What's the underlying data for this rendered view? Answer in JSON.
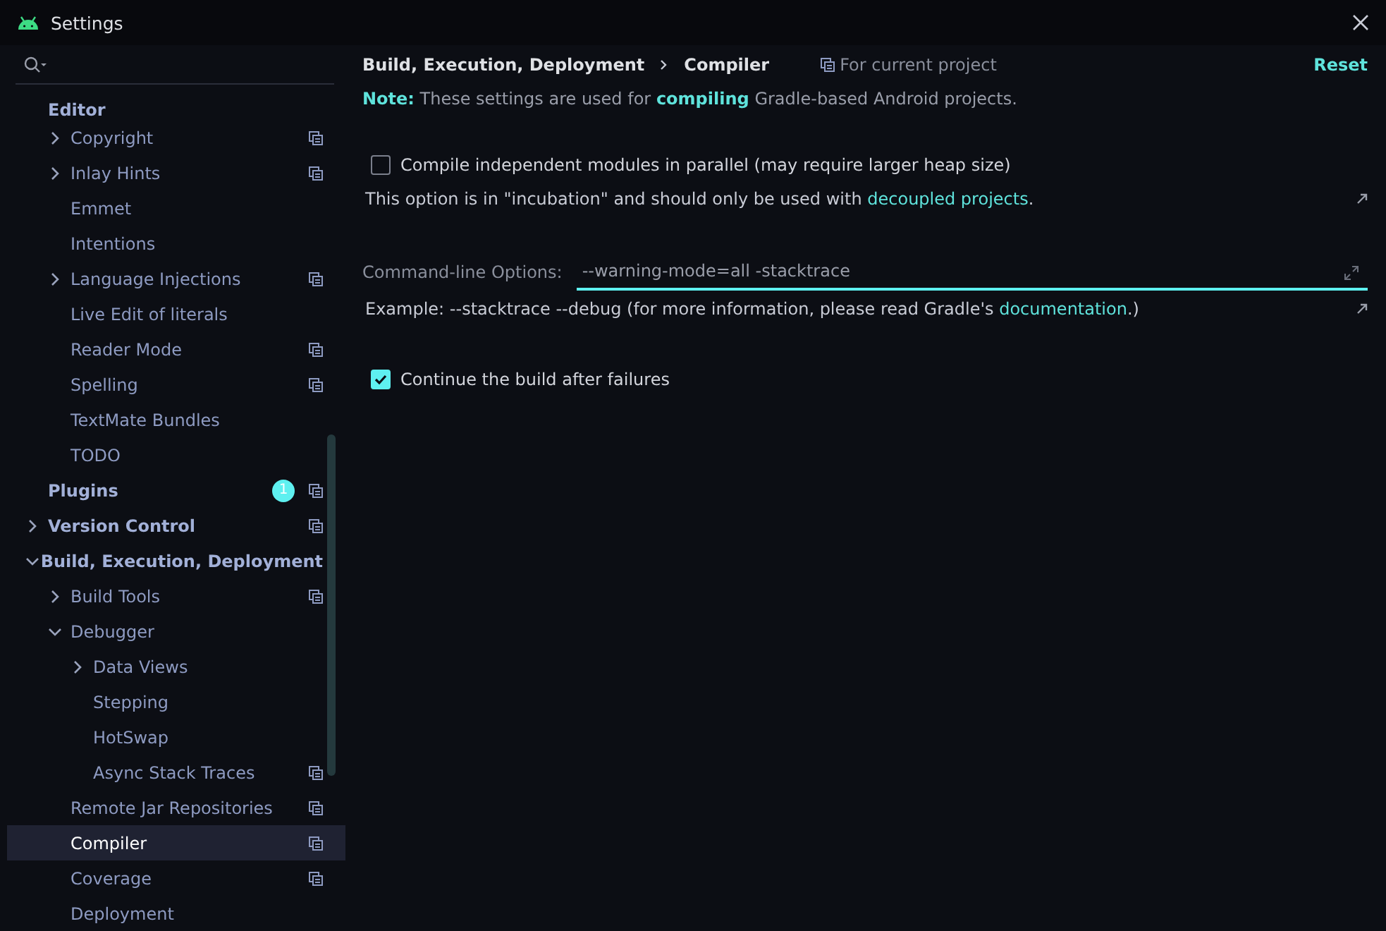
{
  "window": {
    "title": "Settings"
  },
  "sidebar": {
    "tree": [
      {
        "label": "Editor",
        "kind": "heading",
        "selected": false,
        "children": [
          {
            "label": "Copyright",
            "expanded": false,
            "selected": false,
            "project_scope": true
          },
          {
            "label": "Inlay Hints",
            "expanded": false,
            "selected": false,
            "project_scope": true
          },
          {
            "label": "Emmet",
            "selected": false,
            "project_scope": false
          },
          {
            "label": "Intentions",
            "selected": false,
            "project_scope": false
          },
          {
            "label": "Language Injections",
            "expanded": false,
            "selected": false,
            "project_scope": true
          },
          {
            "label": "Live Edit of literals",
            "selected": false,
            "project_scope": false
          },
          {
            "label": "Reader Mode",
            "selected": false,
            "project_scope": true
          },
          {
            "label": "Spelling",
            "selected": false,
            "project_scope": true
          },
          {
            "label": "TextMate Bundles",
            "selected": false,
            "project_scope": false
          },
          {
            "label": "TODO",
            "selected": false,
            "project_scope": false
          }
        ]
      },
      {
        "label": "Plugins",
        "selected": false,
        "project_scope": true,
        "badge": "1"
      },
      {
        "label": "Version Control",
        "expanded": false,
        "selected": false,
        "project_scope": true
      },
      {
        "label": "Build, Execution, Deployment",
        "expanded": true,
        "selected": false,
        "project_scope": false,
        "children": [
          {
            "label": "Build Tools",
            "expanded": false,
            "selected": false,
            "project_scope": true
          },
          {
            "label": "Debugger",
            "expanded": true,
            "selected": false,
            "project_scope": false,
            "children": [
              {
                "label": "Data Views",
                "expanded": false,
                "selected": false,
                "project_scope": false
              },
              {
                "label": "Stepping",
                "selected": false,
                "project_scope": false
              },
              {
                "label": "HotSwap",
                "selected": false,
                "project_scope": false
              },
              {
                "label": "Async Stack Traces",
                "selected": false,
                "project_scope": true
              }
            ]
          },
          {
            "label": "Remote Jar Repositories",
            "selected": false,
            "project_scope": true
          },
          {
            "label": "Compiler",
            "selected": true,
            "project_scope": true
          },
          {
            "label": "Coverage",
            "selected": false,
            "project_scope": true
          },
          {
            "label": "Deployment",
            "selected": false,
            "project_scope": false
          }
        ]
      }
    ]
  },
  "content": {
    "breadcrumb": [
      "Build, Execution, Deployment",
      "Compiler"
    ],
    "scope": "For current project",
    "reset": "Reset",
    "note": "**Note:** These settings are used for **compiling** Gradle-based Android projects.",
    "options": [
      {
        "kind": "checkbox",
        "label": "Compile independent modules in parallel (may require larger heap size)",
        "checked": false,
        "hint": "This option is in \"incubation\" and should only be used with ",
        "hint_link": "decoupled projects",
        "hint_end": "."
      },
      {
        "kind": "field",
        "label": "Command-line Options:",
        "value": "--warning-mode=all -stacktrace",
        "hint": "Example: --stacktrace --debug (for more information, please read Gradle's ",
        "hint_link": "documentation",
        "hint_end": ".)"
      },
      {
        "kind": "checkbox",
        "label": "Continue the build after failures",
        "checked": true
      }
    ]
  }
}
